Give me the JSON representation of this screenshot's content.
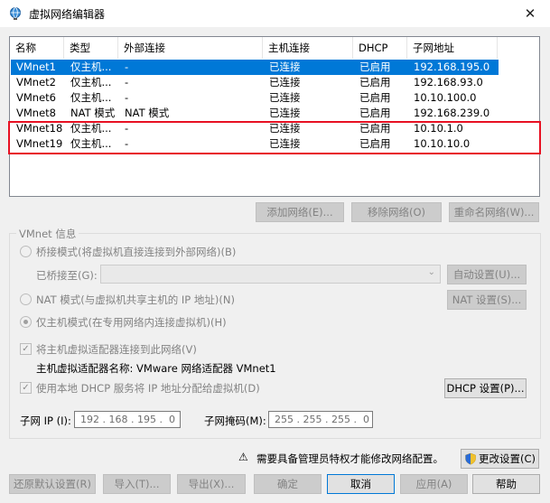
{
  "window": {
    "title": "虚拟网络编辑器",
    "close_glyph": "✕"
  },
  "list": {
    "headers": [
      "名称",
      "类型",
      "外部连接",
      "主机连接",
      "DHCP",
      "子网地址"
    ],
    "rows": [
      [
        "VMnet1",
        "仅主机...",
        "-",
        "已连接",
        "已启用",
        "192.168.195.0"
      ],
      [
        "VMnet2",
        "仅主机...",
        "-",
        "已连接",
        "已启用",
        "192.168.93.0"
      ],
      [
        "VMnet6",
        "仅主机...",
        "-",
        "已连接",
        "已启用",
        "10.10.100.0"
      ],
      [
        "VMnet8",
        "NAT 模式",
        "NAT 模式",
        "已连接",
        "已启用",
        "192.168.239.0"
      ],
      [
        "VMnet18",
        "仅主机...",
        "-",
        "已连接",
        "已启用",
        "10.10.1.0"
      ],
      [
        "VMnet19",
        "仅主机...",
        "-",
        "已连接",
        "已启用",
        "10.10.10.0"
      ]
    ],
    "selected_row": 0,
    "highlighted_rows": [
      4,
      5
    ],
    "highlight_color": "#e81123",
    "selection_color": "#0078d7"
  },
  "list_buttons": {
    "add": "添加网络(E)...",
    "remove": "移除网络(O)",
    "rename": "重命名网络(W)..."
  },
  "vmnet_info": {
    "group_label": "VMnet 信息",
    "bridged_label": "桥接模式(将虚拟机直接连接到外部网络)(B)",
    "bridged_to_label": "已桥接至(G):",
    "bridged_to_value": "",
    "auto_settings": "自动设置(U)...",
    "nat_label": "NAT 模式(与虚拟机共享主机的 IP 地址)(N)",
    "nat_settings": "NAT 设置(S)...",
    "hostonly_label": "仅主机模式(在专用网络内连接虚拟机)(H)",
    "selected_mode": "hostonly",
    "connect_adapter_label": "将主机虚拟适配器连接到此网络(V)",
    "connect_adapter_checked": true,
    "adapter_name_text": "主机虚拟适配器名称: VMware 网络适配器 VMnet1",
    "dhcp_label": "使用本地 DHCP 服务将 IP 地址分配给虚拟机(D)",
    "dhcp_checked": true,
    "dhcp_settings": "DHCP 设置(P)...",
    "subnet_ip_label": "子网 IP (I):",
    "subnet_ip_value": "192 . 168 . 195 .  0",
    "subnet_mask_label": "子网掩码(M):",
    "subnet_mask_value": "255 . 255 . 255 .  0"
  },
  "admin": {
    "warn_glyph": "⚠",
    "notice": "需要具备管理员特权才能修改网络配置。",
    "change_settings": "更改设置(C)"
  },
  "footer": {
    "restore": "还原默认设置(R)",
    "import": "导入(T)...",
    "export": "导出(X)...",
    "ok": "确定",
    "cancel": "取消",
    "apply": "应用(A)",
    "help": "帮助"
  }
}
